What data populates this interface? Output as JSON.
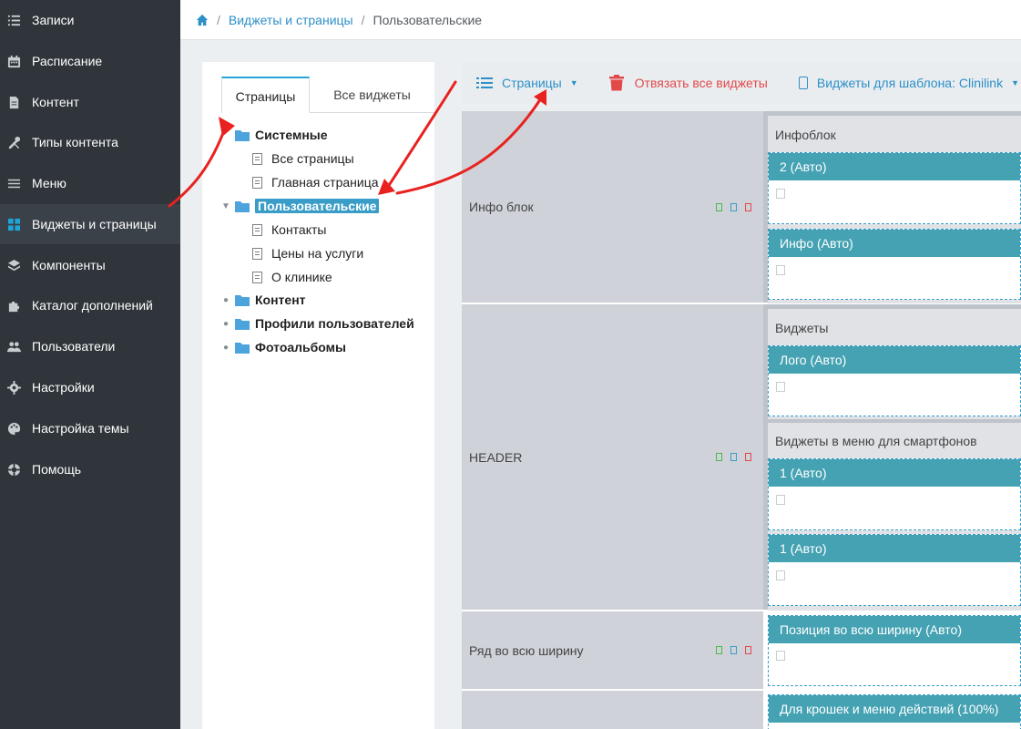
{
  "sidebar": {
    "items": [
      {
        "label": "Записи",
        "icon": "list-icon"
      },
      {
        "label": "Расписание",
        "icon": "calendar-icon"
      },
      {
        "label": "Контент",
        "icon": "document-icon"
      },
      {
        "label": "Типы контента",
        "icon": "tools-icon"
      },
      {
        "label": "Меню",
        "icon": "menu-icon"
      },
      {
        "label": "Виджеты и страницы",
        "icon": "grid-icon"
      },
      {
        "label": "Компоненты",
        "icon": "layers-icon"
      },
      {
        "label": "Каталог дополнений",
        "icon": "puzzle-icon"
      },
      {
        "label": "Пользователи",
        "icon": "users-icon"
      },
      {
        "label": "Настройки",
        "icon": "gear-icon"
      },
      {
        "label": "Настройка темы",
        "icon": "palette-icon"
      },
      {
        "label": "Помощь",
        "icon": "help-icon"
      }
    ],
    "active_index": 5
  },
  "breadcrumb": {
    "home_icon": "home-icon",
    "link": "Виджеты и страницы",
    "current": "Пользовательские"
  },
  "tree_panel": {
    "tabs": [
      "Страницы",
      "Все виджеты"
    ],
    "nodes": {
      "system": "Системные",
      "all_pages": "Все страницы",
      "main_page": "Главная страница",
      "custom": "Пользовательские",
      "contacts": "Контакты",
      "prices": "Цены на услуги",
      "about": "О клинике",
      "content": "Контент",
      "profiles": "Профили пользователей",
      "albums": "Фотоальбомы"
    }
  },
  "toolbar": {
    "pages": "Страницы",
    "unbind_all": "Отвязать все виджеты",
    "template_widgets": "Виджеты для шаблона: Clinilink"
  },
  "layout": {
    "infoblock": {
      "label": "Инфо блок",
      "group": "Инфоблок",
      "widgets": [
        "2 (Авто)",
        "Инфо (Авто)"
      ]
    },
    "header": {
      "label": "HEADER",
      "group1": "Виджеты",
      "group1_widgets": [
        "Лого (Авто)"
      ],
      "group2": "Виджеты в меню для смартфонов",
      "group2_widgets": [
        "1 (Авто)",
        "1 (Авто)"
      ]
    },
    "fullwidth": {
      "label": "Ряд во всю ширину",
      "widgets": [
        "Позиция во всю ширину (Авто)"
      ]
    },
    "crumbs_row": {
      "widgets": [
        "Для крошек и меню действий (100%)"
      ]
    }
  },
  "colors": {
    "sidebar_bg": "#2f353a",
    "accent": "#1ea6d8",
    "widget_head": "#45a2b3",
    "danger": "#e24a4a",
    "annotation_arrow": "#e8221f"
  }
}
